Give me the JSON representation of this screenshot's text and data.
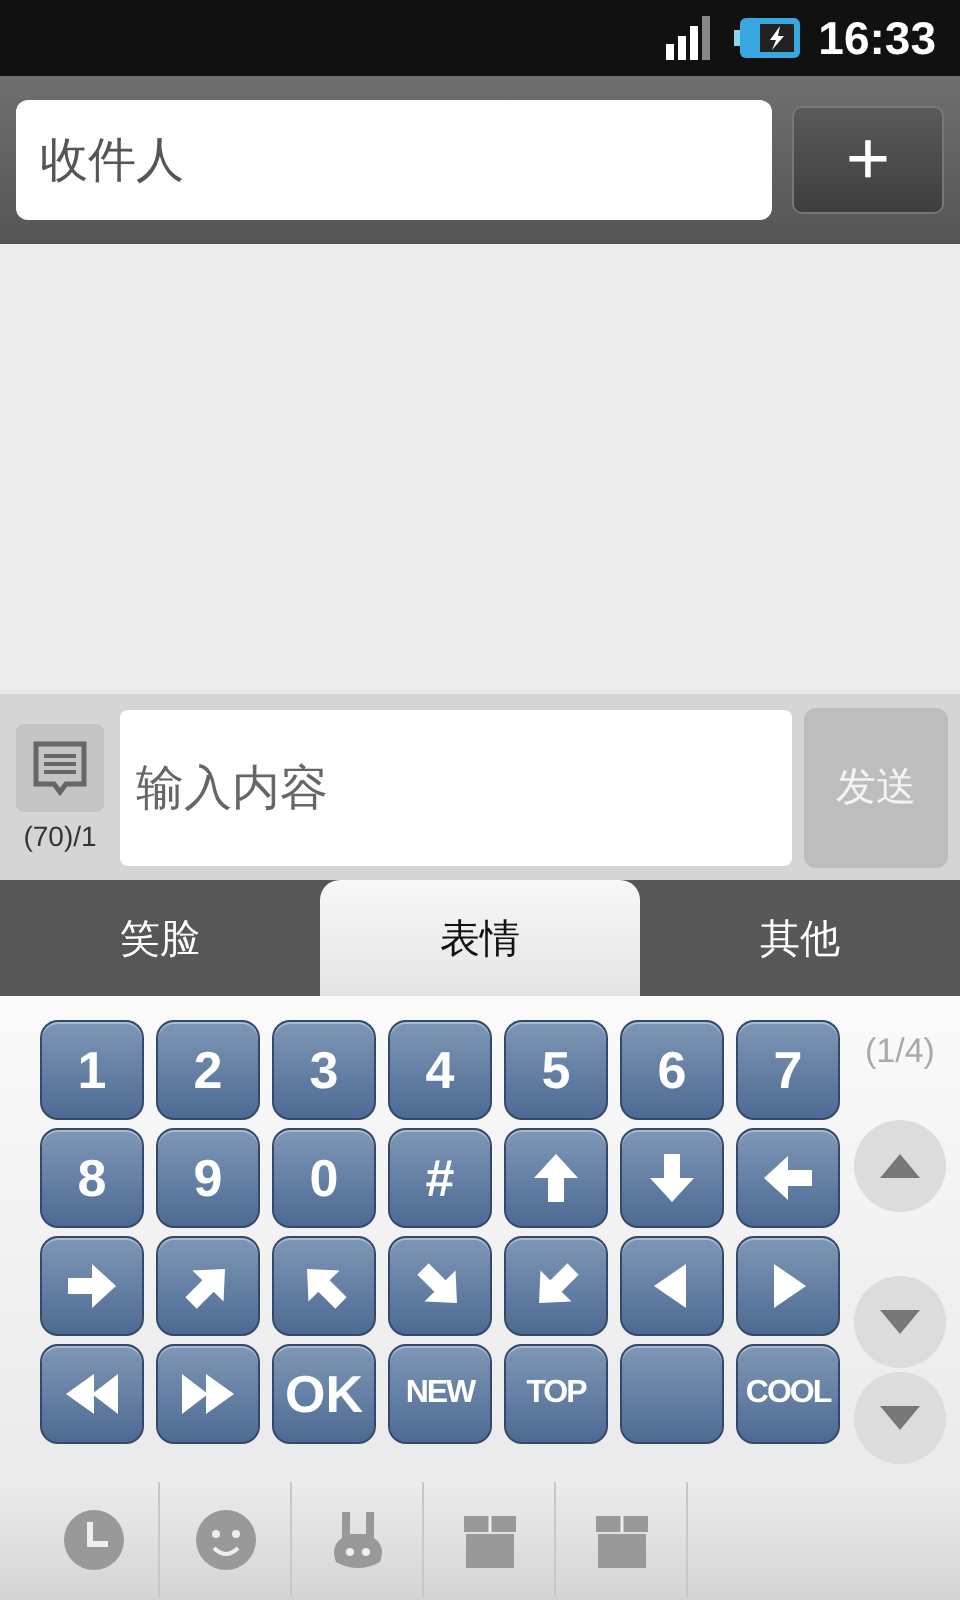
{
  "status_bar": {
    "time": "16:33"
  },
  "recipient": {
    "placeholder": "收件人",
    "add_button": "+"
  },
  "compose": {
    "counter": "(70)/1",
    "placeholder": "输入内容",
    "send": "发送"
  },
  "tabs": [
    {
      "label": "笑脸",
      "selected": false
    },
    {
      "label": "表情",
      "selected": true
    },
    {
      "label": "其他",
      "selected": false
    }
  ],
  "keys": [
    {
      "kind": "text",
      "label": "1"
    },
    {
      "kind": "text",
      "label": "2"
    },
    {
      "kind": "text",
      "label": "3"
    },
    {
      "kind": "text",
      "label": "4"
    },
    {
      "kind": "text",
      "label": "5"
    },
    {
      "kind": "text",
      "label": "6"
    },
    {
      "kind": "text",
      "label": "7"
    },
    {
      "kind": "text",
      "label": "8"
    },
    {
      "kind": "text",
      "label": "9"
    },
    {
      "kind": "text",
      "label": "0"
    },
    {
      "kind": "text",
      "label": "#"
    },
    {
      "kind": "arrow_up"
    },
    {
      "kind": "arrow_down"
    },
    {
      "kind": "arrow_left"
    },
    {
      "kind": "arrow_right"
    },
    {
      "kind": "arrow_upright"
    },
    {
      "kind": "arrow_upleft"
    },
    {
      "kind": "arrow_downright"
    },
    {
      "kind": "arrow_downleft"
    },
    {
      "kind": "triangle_left"
    },
    {
      "kind": "triangle_right"
    },
    {
      "kind": "double_left"
    },
    {
      "kind": "double_right"
    },
    {
      "kind": "text",
      "label": "OK"
    },
    {
      "kind": "text",
      "label": "NEW"
    },
    {
      "kind": "text",
      "label": "TOP"
    },
    {
      "kind": "blank"
    },
    {
      "kind": "text",
      "label": "COOL"
    }
  ],
  "pager": {
    "page": "(1/4)",
    "buttons": [
      {
        "kind": "up"
      },
      {
        "kind": "down"
      },
      {
        "kind": "down"
      }
    ]
  },
  "categories": [
    {
      "kind": "clock"
    },
    {
      "kind": "smiley"
    },
    {
      "kind": "rabbit"
    },
    {
      "kind": "box"
    },
    {
      "kind": "box"
    }
  ]
}
